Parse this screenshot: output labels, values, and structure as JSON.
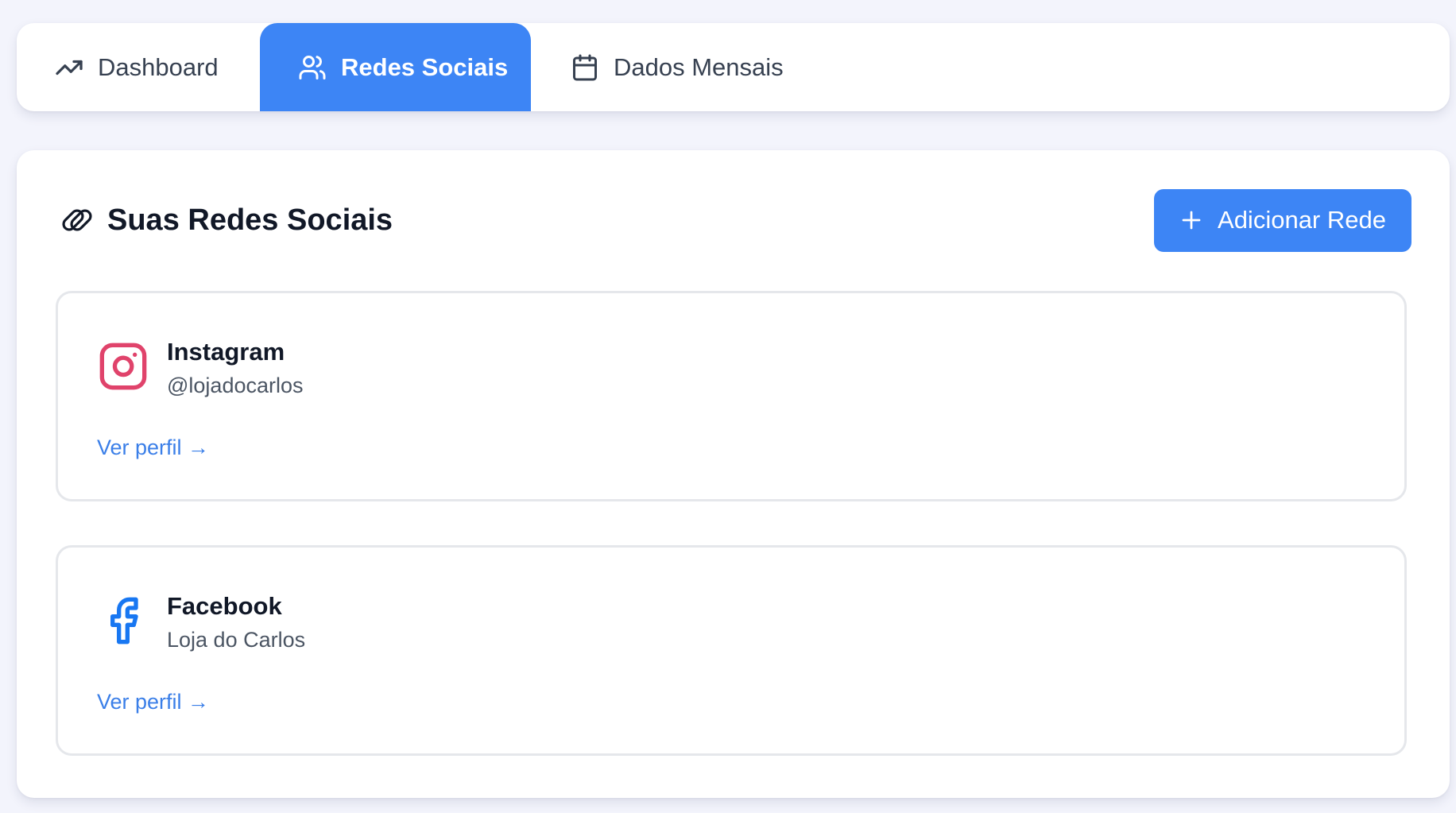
{
  "tabs": [
    {
      "label": "Dashboard",
      "icon": "trending-up-icon"
    },
    {
      "label": "Redes Sociais",
      "icon": "users-icon",
      "active": true
    },
    {
      "label": "Dados Mensais",
      "icon": "calendar-icon"
    }
  ],
  "section": {
    "title": "Suas Redes Sociais",
    "title_icon": "link-icon",
    "add_button_label": "Adicionar Rede"
  },
  "networks": [
    {
      "name": "Instagram",
      "handle": "@lojadocarlos",
      "link_label": "Ver perfil →",
      "icon": "instagram-icon",
      "color": "#e1306c"
    },
    {
      "name": "Facebook",
      "handle": "Loja do Carlos",
      "link_label": "Ver perfil →",
      "icon": "facebook-icon",
      "color": "#1877f2"
    }
  ],
  "colors": {
    "accent": "#3d85f5",
    "background": "#f3f4fc",
    "card": "#ffffff"
  }
}
